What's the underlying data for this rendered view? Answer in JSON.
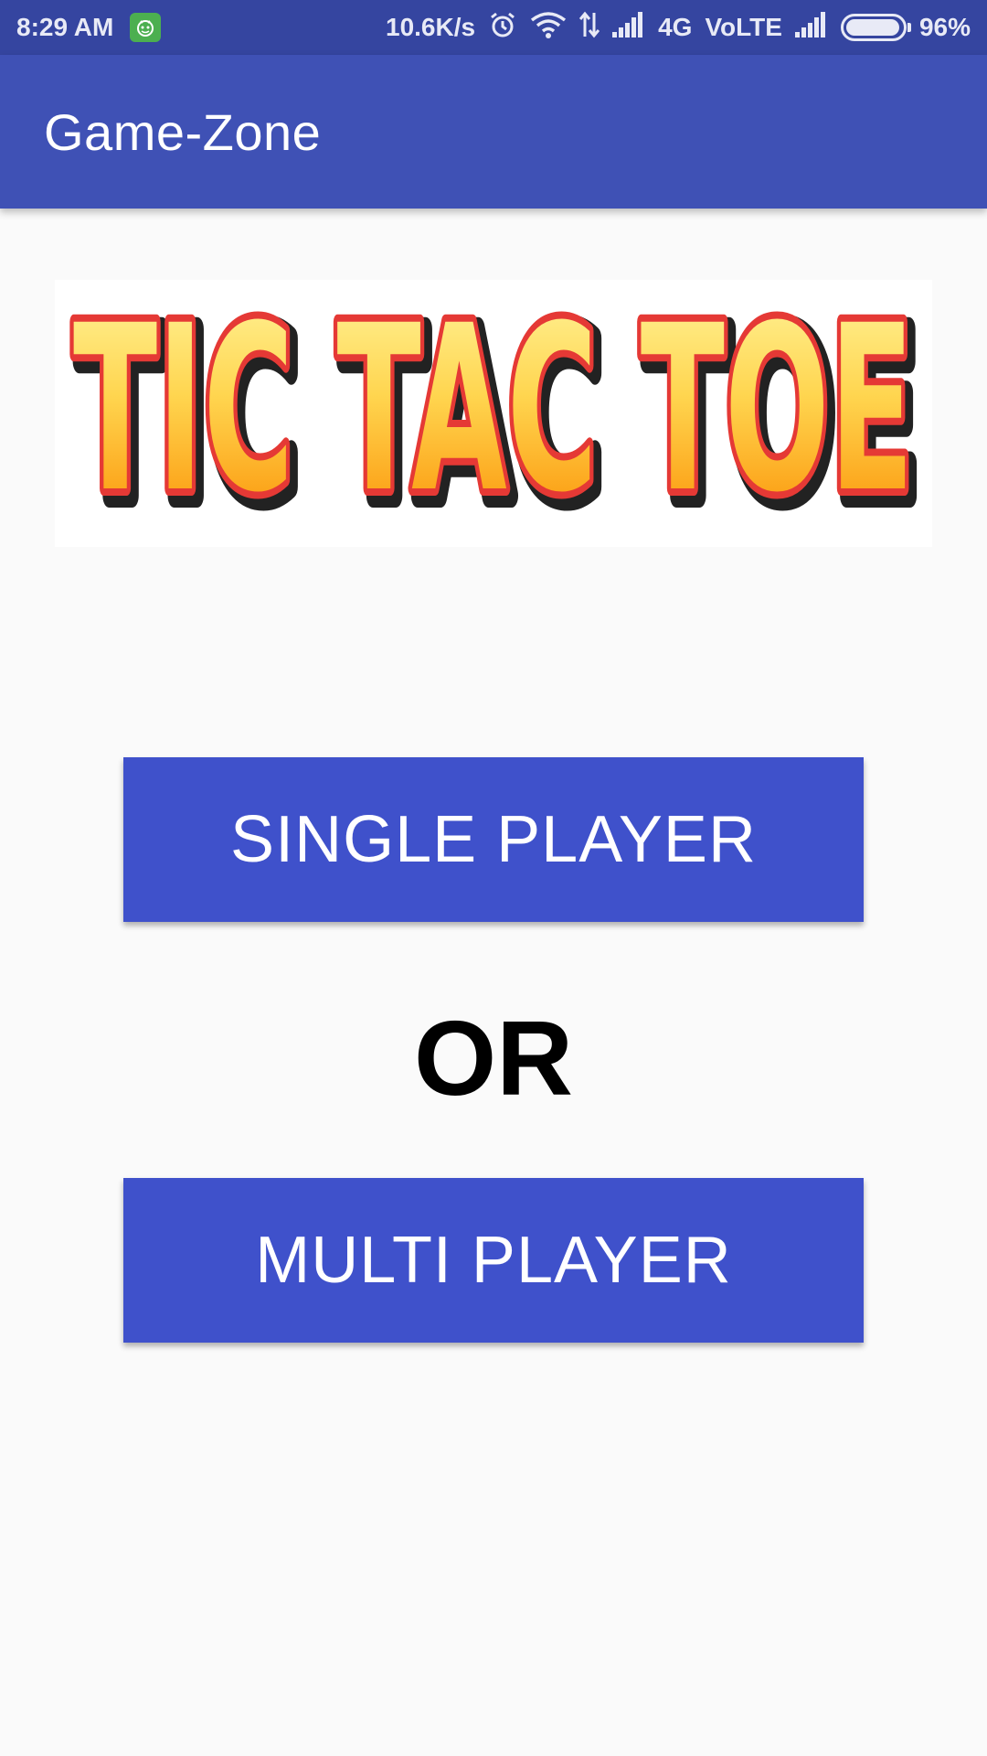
{
  "status_bar": {
    "time": "8:29 AM",
    "network_speed": "10.6K/s",
    "network_type": "4G",
    "volte": "VoLTE",
    "battery": "96%",
    "battery_level": 0.96,
    "icons": [
      "notification-app-icon",
      "alarm-icon",
      "wifi-icon",
      "data-transfer-icon",
      "signal-icon",
      "signal-icon-2",
      "battery-icon"
    ]
  },
  "app_bar": {
    "title": "Game-Zone"
  },
  "banner": {
    "logo_text": "TIC TAC TOE"
  },
  "buttons": {
    "single_player": "SINGLE PLAYER",
    "multi_player": "MULTI PLAYER"
  },
  "separator": "OR",
  "colors": {
    "status_bar": "#3545a0",
    "app_bar": "#3f51b5",
    "button": "#3f51cb",
    "logo_fill_top": "#fff176",
    "logo_fill_bottom": "#ff9800",
    "logo_outline": "#e53935"
  }
}
